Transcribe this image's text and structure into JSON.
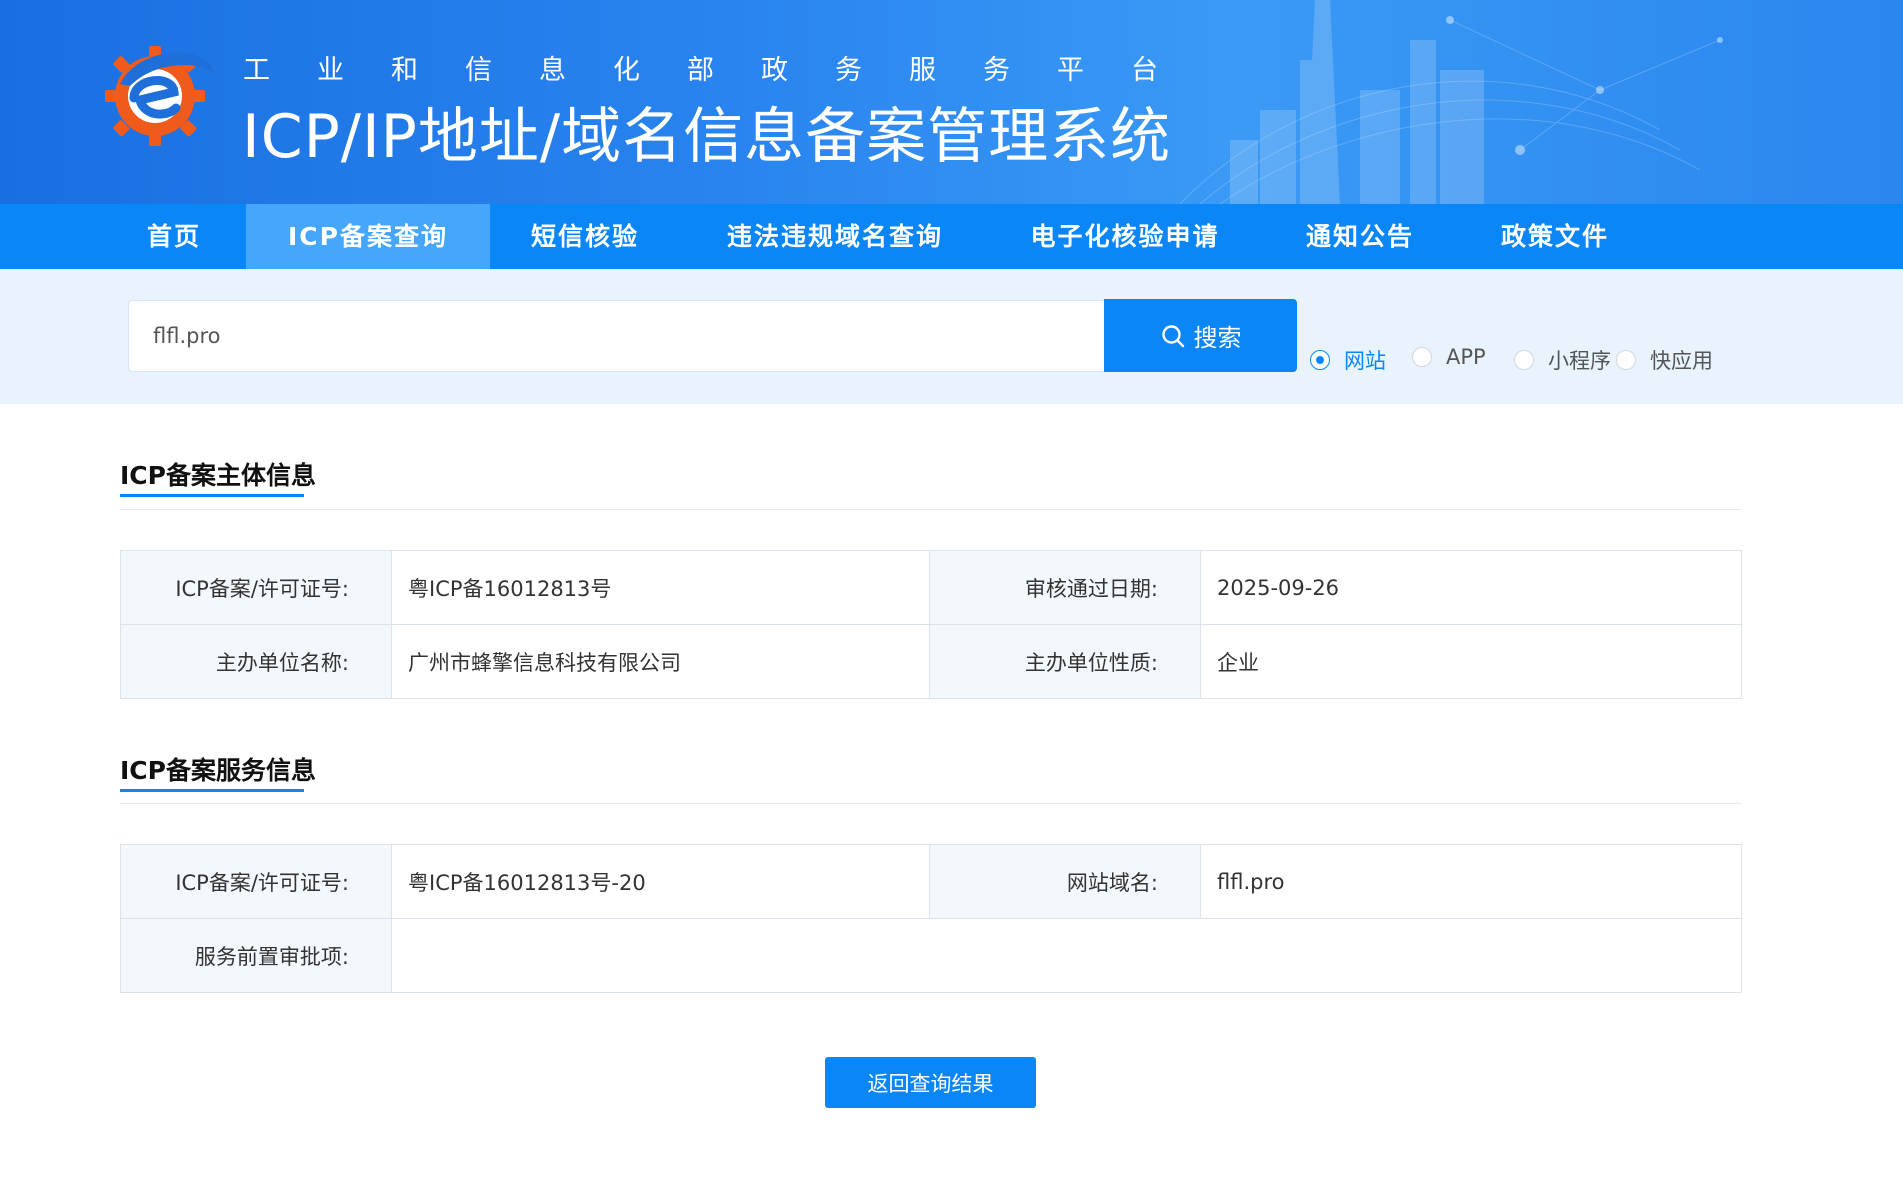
{
  "header": {
    "subtitle": "工业和信息化部政务服务平台",
    "title": "ICP/IP地址/域名信息备案管理系统",
    "logo_icon": "gear-e-logo-icon",
    "colors": {
      "banner_start": "#1a6fe0",
      "banner_end": "#3a9af5",
      "logo_orange": "#f05a1a",
      "logo_blue": "#1e6fd9"
    }
  },
  "nav": {
    "items": [
      {
        "label": "首页",
        "active": false
      },
      {
        "label": "ICP备案查询",
        "active": true
      },
      {
        "label": "短信核验",
        "active": false
      },
      {
        "label": "违法违规域名查询",
        "active": false
      },
      {
        "label": "电子化核验申请",
        "active": false
      },
      {
        "label": "通知公告",
        "active": false
      },
      {
        "label": "政策文件",
        "active": false
      }
    ],
    "color": "#0b86f7",
    "active_color": "#45a6fb"
  },
  "search": {
    "value": "flfl.pro",
    "button_label": "搜索",
    "button_icon": "search-icon",
    "types": [
      {
        "label": "网站",
        "checked": true
      },
      {
        "label": "APP",
        "checked": false
      },
      {
        "label": "小程序",
        "checked": false
      },
      {
        "label": "快应用",
        "checked": false
      }
    ]
  },
  "subject_info": {
    "title": "ICP备案主体信息",
    "rows": [
      {
        "l1": "ICP备案/许可证号:",
        "v1": "粤ICP备16012813号",
        "l2": "审核通过日期:",
        "v2": "2025-09-26"
      },
      {
        "l1": "主办单位名称:",
        "v1": "广州市蜂擎信息科技有限公司",
        "l2": "主办单位性质:",
        "v2": "企业"
      }
    ]
  },
  "service_info": {
    "title": "ICP备案服务信息",
    "row1": {
      "l1": "ICP备案/许可证号:",
      "v1": "粤ICP备16012813号-20",
      "l2": "网站域名:",
      "v2": "flfl.pro"
    },
    "row2": {
      "l1": "服务前置审批项:",
      "v1": ""
    }
  },
  "back_button": {
    "label": "返回查询结果"
  }
}
